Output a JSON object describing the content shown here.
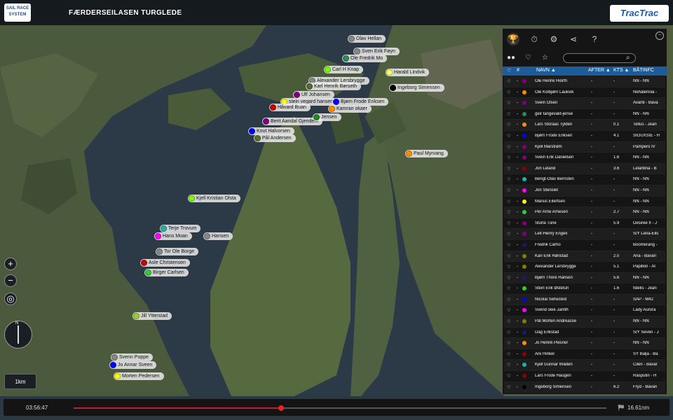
{
  "header": {
    "logo_text": "SAIL RACE SYSTEM",
    "title": "FÆRDERSEILASEN TURGLEDE",
    "brand": "TracTrac"
  },
  "map": {
    "boat_labels": [
      {
        "name": "Olav Hellan",
        "color": "#888888"
      },
      {
        "name": "Sven Erik Føyn",
        "color": "#888888"
      },
      {
        "name": "Ole Fredrik Mo",
        "color": "#2e8b57"
      },
      {
        "name": "Carl H Knap",
        "color": "#7cfc00"
      },
      {
        "name": "Harald Lindvik",
        "color": "#ffff66"
      },
      {
        "name": "Alexander Lersbrygge",
        "color": "#888888"
      },
      {
        "name": "Karl Henrik Børseth",
        "color": "#556b2f"
      },
      {
        "name": "Ingeborg Simensen",
        "color": "#000000"
      },
      {
        "name": "Ulf Johansen",
        "color": "#800080"
      },
      {
        "name": "stein vegard hansen",
        "color": "#ffff00"
      },
      {
        "name": "Bjørn Frode Eriksen",
        "color": "#0000ff"
      },
      {
        "name": "Håvard Buan",
        "color": "#cc0000"
      },
      {
        "name": "Kamran okaer",
        "color": "#ff8c00"
      },
      {
        "name": "Berit Aandal Gjendem",
        "color": "#800080"
      },
      {
        "name": "Jensen",
        "color": "#228b22"
      },
      {
        "name": "Knut Halvorsen",
        "color": "#0000ff"
      },
      {
        "name": "Pål Andersen",
        "color": "#556b2f"
      },
      {
        "name": "Paul Myrvang",
        "color": "#ff8c00"
      },
      {
        "name": "Kjell Kristian Olsta",
        "color": "#7cfc00"
      },
      {
        "name": "Terje Trovum",
        "color": "#20b2aa"
      },
      {
        "name": "Hans Moan",
        "color": "#ff00ff"
      },
      {
        "name": "Hansen",
        "color": "#888888"
      },
      {
        "name": "Tor Ole Borge",
        "color": "#888888"
      },
      {
        "name": "Asle Christensen",
        "color": "#cc0000"
      },
      {
        "name": "Birger Carlsen",
        "color": "#32cd32"
      },
      {
        "name": "Jill Ytterstad",
        "color": "#9acd32"
      },
      {
        "name": "Svenn Poppe",
        "color": "#888888"
      },
      {
        "name": "Jo Annar Sveen",
        "color": "#0000ff"
      },
      {
        "name": "Morten Pedersen",
        "color": "#ffff00"
      }
    ],
    "zoom_in": "+",
    "zoom_out": "−",
    "locate": "◎",
    "compass_n": "N",
    "scale_label": "1km"
  },
  "panel": {
    "tabs": [
      "trophy-icon",
      "stopwatch-icon",
      "settings-icon",
      "share-icon",
      "help-icon"
    ],
    "search_placeholder": "",
    "columns": {
      "num": "#",
      "name": "NAVN ▲",
      "after": "AFTER ▲",
      "kts": "KTS ▲",
      "boat": "BÅTINFC"
    },
    "rows": [
      {
        "color": "#800080",
        "name": "Ole Henrik Hiorth",
        "after": "-",
        "kts": "-",
        "boat": "NN - NN"
      },
      {
        "color": "#ff8c00",
        "name": "Ole Kolbjørn Laukvik",
        "after": "-",
        "kts": "-",
        "boat": "Nehalennia -"
      },
      {
        "color": "#800080",
        "name": "Svein Olsen",
        "after": "-",
        "kts": "-",
        "boat": "Avanti - Bava"
      },
      {
        "color": "#2e8b57",
        "name": "geir tangevald-jense",
        "after": "-",
        "kts": "-",
        "boat": "NN - NN"
      },
      {
        "color": "#ff8c00",
        "name": "Lars Storaas Tylden",
        "after": "-",
        "kts": "0.1",
        "boat": "Tellus - Jean"
      },
      {
        "color": "#0000ff",
        "name": "Bjørn Frode Eriksen",
        "after": "-",
        "kts": "4.1",
        "boat": "SIOUXSIE - H"
      },
      {
        "color": "#800080",
        "name": "Kjell Marstrøm",
        "after": "-",
        "kts": "-",
        "boat": "Pampero IV"
      },
      {
        "color": "#800080",
        "name": "Svein Erik Danielsen",
        "after": "-",
        "kts": "1.6",
        "boat": "NN - NN"
      },
      {
        "color": "#8b0000",
        "name": "Jon Leland",
        "after": "-",
        "kts": "3.6",
        "boat": "Lelantina - B"
      },
      {
        "color": "#20b2aa",
        "name": "Bengt-Olav Bernsten",
        "after": "-",
        "kts": "-",
        "boat": "NN - NN"
      },
      {
        "color": "#ff00ff",
        "name": "Jon Stenslet",
        "after": "-",
        "kts": "-",
        "boat": "NN - NN"
      },
      {
        "color": "#ffff00",
        "name": "Marius Eilertsen",
        "after": "-",
        "kts": "-",
        "boat": "NN - NN"
      },
      {
        "color": "#32cd32",
        "name": "Per Arne Arnesen",
        "after": "-",
        "kts": "2.7",
        "boat": "NN - NN"
      },
      {
        "color": "#800080",
        "name": "Sturla Tune",
        "after": "-",
        "kts": "5.9",
        "boat": "Desiree II - J"
      },
      {
        "color": "#800080",
        "name": "Leif-Henry Engeli",
        "after": "-",
        "kts": "-",
        "boat": "S/Y Lena-Elis"
      },
      {
        "color": "#191970",
        "name": "Fredrik Carho",
        "after": "-",
        "kts": "-",
        "boat": "Boomerang -"
      },
      {
        "color": "#808000",
        "name": "Kari Erik Rønstad",
        "after": "-",
        "kts": "2.0",
        "boat": "Aria - Bavari"
      },
      {
        "color": "#808000",
        "name": "Alexander Lersbrygge",
        "after": "-",
        "kts": "5.1",
        "boat": "Papillon - Al"
      },
      {
        "color": "#191970",
        "name": "Bjørn Thore Hansen",
        "after": "-",
        "kts": "5.6",
        "boat": "NN - NN"
      },
      {
        "color": "#32cd32",
        "name": "Stein Erik Østetun",
        "after": "-",
        "kts": "1.6",
        "boat": "fidelis - Jean"
      },
      {
        "color": "#0000ff",
        "name": "Nicolai Sehested",
        "after": "-",
        "kts": "-",
        "boat": "SAP - M42"
      },
      {
        "color": "#ff00ff",
        "name": "Svend owe Jamth",
        "after": "-",
        "kts": "-",
        "boat": "Lady Aurora"
      },
      {
        "color": "#808000",
        "name": "Pål Morten Andreasse",
        "after": "-",
        "kts": "-",
        "boat": "NN - NN"
      },
      {
        "color": "#191970",
        "name": "Dag Erikstad",
        "after": "-",
        "kts": "-",
        "boat": "S/Y Seven - J"
      },
      {
        "color": "#ff8c00",
        "name": "Jo Henrik Plesner",
        "after": "-",
        "kts": "-",
        "boat": "NN - NN"
      },
      {
        "color": "#8b0000",
        "name": "Are Hinkel",
        "after": "-",
        "kts": "-",
        "boat": "SY Balja - Ba"
      },
      {
        "color": "#20b2aa",
        "name": "Kjell Gunnar Wåden",
        "after": "-",
        "kts": "-",
        "boat": "Cilen - Bavar"
      },
      {
        "color": "#8b0000",
        "name": "Lars Frode Haugen",
        "after": "-",
        "kts": "-",
        "boat": "Rasputin - H"
      },
      {
        "color": "#000000",
        "name": "Ingeborg Simensen",
        "after": "-",
        "kts": "6.2",
        "boat": "Fryd - Bavari"
      },
      {
        "color": "#ffff00",
        "name": "Bruno Jean Pierre Le",
        "after": "-",
        "kts": "-",
        "boat": "Thallasia - C"
      }
    ]
  },
  "timeline": {
    "time": "03:56:47",
    "distance": "16.61nm",
    "progress": 0.39
  }
}
